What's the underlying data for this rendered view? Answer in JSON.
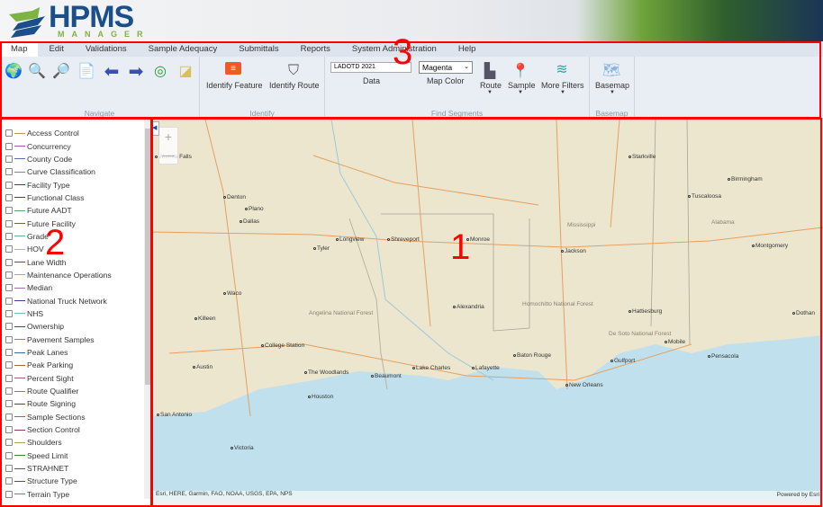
{
  "header": {
    "logo_main": "HPMS",
    "logo_sub": "MANAGER"
  },
  "ribbon": {
    "tabs": [
      "Map",
      "Edit",
      "Validations",
      "Sample Adequacy",
      "Submittals",
      "Reports",
      "System Administration",
      "Help"
    ],
    "active_tab": "Map",
    "navigate": {
      "label": "Navigate",
      "icons": [
        "globe-icon",
        "zoom-in-icon",
        "zoom-out-icon",
        "document-search-icon",
        "back-arrow-icon",
        "forward-arrow-icon",
        "locate-icon",
        "eraser-icon"
      ]
    },
    "identify": {
      "label": "Identify",
      "identify_feature": "Identify Feature",
      "identify_route": "Identify Route"
    },
    "find_segments": {
      "label": "Find Segments",
      "data_value": "LADOTD 2021",
      "data_label": "Data",
      "map_color_value": "Magenta",
      "map_color_label": "Map Color",
      "route": "Route",
      "sample": "Sample",
      "more_filters": "More Filters"
    },
    "basemap": {
      "label": "Basemap",
      "button": "Basemap"
    }
  },
  "sidebar": {
    "layers": [
      {
        "label": "Access Control",
        "color": "#b59a5a"
      },
      {
        "label": "Concurrency",
        "color": "#9c5aa8"
      },
      {
        "label": "County Code",
        "color": "#5a6fa8"
      },
      {
        "label": "Curve Classification",
        "color": "#b06ab0"
      },
      {
        "label": "Facility Type",
        "color": "#7a2a4a"
      },
      {
        "label": "Functional Class",
        "color": "#4a3a7a"
      },
      {
        "label": "Future AADT",
        "color": "#5aa86a"
      },
      {
        "label": "Future Facility",
        "color": "#6a6a3a"
      },
      {
        "label": "Grade",
        "color": "#6ab08a"
      },
      {
        "label": "HOV",
        "color": "#c8b86a"
      },
      {
        "label": "Lane Width",
        "color": "#3a5a8a"
      },
      {
        "label": "Maintenance Operations",
        "color": "#c89a7a"
      },
      {
        "label": "Median",
        "color": "#a86aa8"
      },
      {
        "label": "National Truck Network",
        "color": "#3a3a9a"
      },
      {
        "label": "NHS",
        "color": "#6ac0b0"
      },
      {
        "label": "Ownership",
        "color": "#7a3a3a"
      },
      {
        "label": "Pavement Samples",
        "color": "#5aa85a"
      },
      {
        "label": "Peak Lanes",
        "color": "#3a6aa8"
      },
      {
        "label": "Peak Parking",
        "color": "#9a6a3a"
      },
      {
        "label": "Percent Sight",
        "color": "#a85a8a"
      },
      {
        "label": "Route Qualifier",
        "color": "#8a8a3a"
      },
      {
        "label": "Route Signing",
        "color": "#5a3a8a"
      },
      {
        "label": "Sample Sections",
        "color": "#3a8aa8"
      },
      {
        "label": "Section Control",
        "color": "#8a3a5a"
      },
      {
        "label": "Shoulders",
        "color": "#a8a85a"
      },
      {
        "label": "Speed Limit",
        "color": "#3a7a3a"
      },
      {
        "label": "STRAHNET",
        "color": "#5a5a5a"
      },
      {
        "label": "Structure Type",
        "color": "#6a3aa8"
      },
      {
        "label": "Terrain Type",
        "color": "#3aa86a"
      }
    ]
  },
  "map": {
    "cities": [
      "Wichita Falls",
      "Denton",
      "Plano",
      "Dallas",
      "Tyler",
      "Longview",
      "Shreveport",
      "Monroe",
      "Waco",
      "Killeen",
      "College Station",
      "Austin",
      "The Woodlands",
      "Houston",
      "San Antonio",
      "Victoria",
      "Beaumont",
      "Lake Charles",
      "Lafayette",
      "Baton Rouge",
      "New Orleans",
      "Alexandria",
      "Jackson",
      "Hattiesburg",
      "Gulfport",
      "Mobile",
      "Pensacola",
      "Montgomery",
      "Birmingham",
      "Tuscaloosa",
      "Starkville",
      "Dothan",
      "Mississippi",
      "Alabama",
      "Angelina National Forest",
      "Homochitto National Forest",
      "De Soto National Forest"
    ],
    "attribution": "Esri, HERE, Garmin, FAO, NOAA, USGS, EPA, NPS",
    "powered_by": "Powered by Esri",
    "zoom_in": "+",
    "zoom_out": "—"
  },
  "annotations": {
    "map": "1",
    "sidebar": "2",
    "ribbon": "3"
  }
}
